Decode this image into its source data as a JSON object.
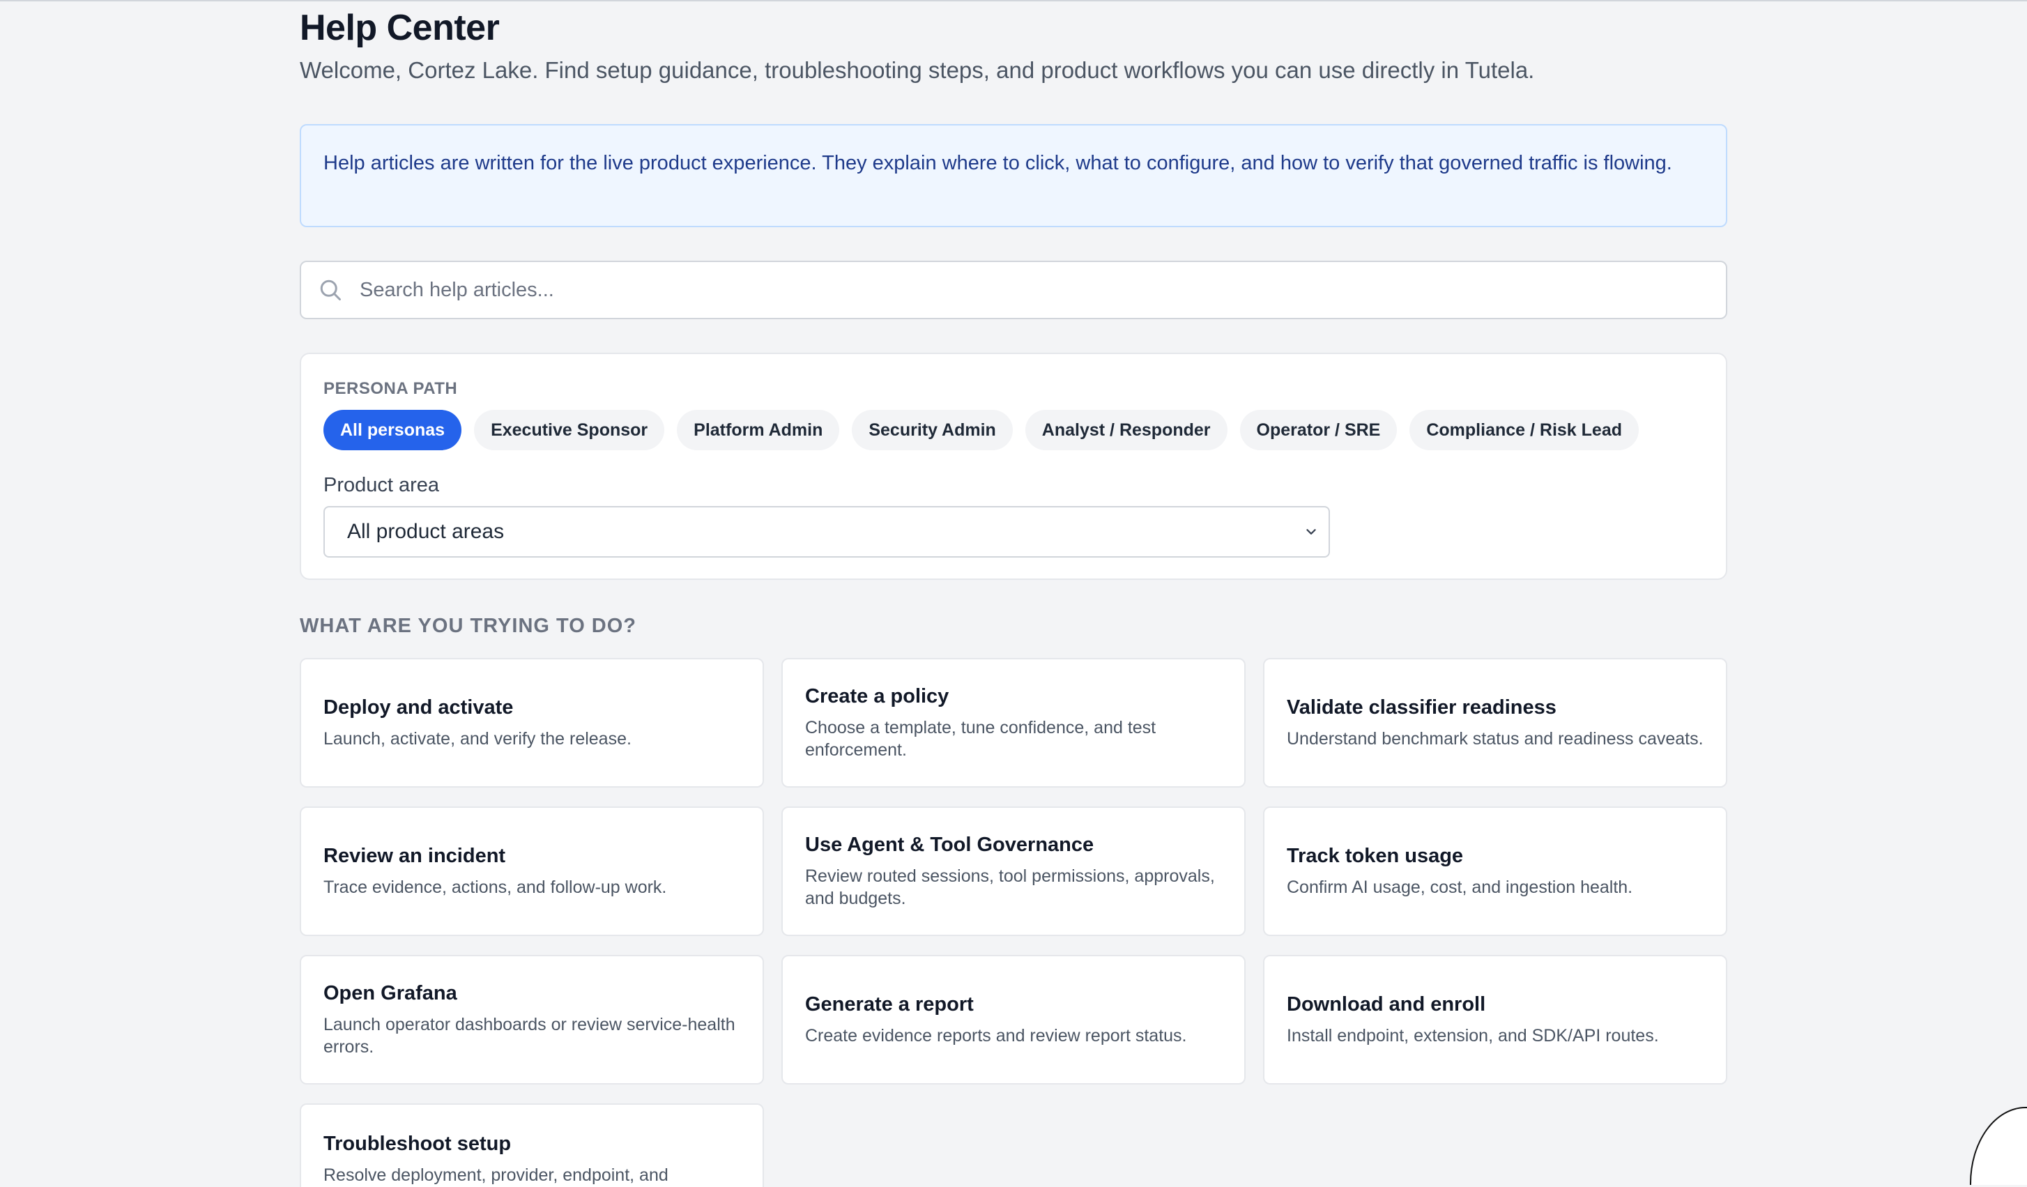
{
  "header": {
    "title": "Help Center",
    "subtitle": "Welcome, Cortez Lake. Find setup guidance, troubleshooting steps, and product workflows you can use directly in Tutela."
  },
  "notice": {
    "text": "Help articles are written for the live product experience. They explain where to click, what to configure, and how to verify that governed traffic is flowing."
  },
  "search": {
    "placeholder": "Search help articles...",
    "icon": "search-icon"
  },
  "filters": {
    "persona_label": "PERSONA PATH",
    "personas": [
      {
        "label": "All personas",
        "active": true
      },
      {
        "label": "Executive Sponsor",
        "active": false
      },
      {
        "label": "Platform Admin",
        "active": false
      },
      {
        "label": "Security Admin",
        "active": false
      },
      {
        "label": "Analyst / Responder",
        "active": false
      },
      {
        "label": "Operator / SRE",
        "active": false
      },
      {
        "label": "Compliance / Risk Lead",
        "active": false
      }
    ],
    "area_label": "Product area",
    "area_selected": "All product areas"
  },
  "tasks": {
    "heading": "WHAT ARE YOU TRYING TO DO?",
    "cards": [
      {
        "title": "Deploy and activate",
        "desc": "Launch, activate, and verify the release."
      },
      {
        "title": "Create a policy",
        "desc": "Choose a template, tune confidence, and test enforcement."
      },
      {
        "title": "Validate classifier readiness",
        "desc": "Understand benchmark status and readiness caveats."
      },
      {
        "title": "Review an incident",
        "desc": "Trace evidence, actions, and follow-up work."
      },
      {
        "title": "Use Agent & Tool Governance",
        "desc": "Review routed sessions, tool permissions, approvals, and budgets."
      },
      {
        "title": "Track token usage",
        "desc": "Confirm AI usage, cost, and ingestion health."
      },
      {
        "title": "Open Grafana",
        "desc": "Launch operator dashboards or review service-health errors."
      },
      {
        "title": "Generate a report",
        "desc": "Create evidence reports and review report status."
      },
      {
        "title": "Download and enroll",
        "desc": "Install endpoint, extension, and SDK/API routes."
      },
      {
        "title": "Troubleshoot setup",
        "desc": "Resolve deployment, provider, endpoint, and"
      }
    ]
  },
  "colors": {
    "accent": "#2563eb",
    "notice_bg": "#eff6ff",
    "notice_text": "#1e3a8a",
    "page_bg": "#f3f4f6"
  }
}
